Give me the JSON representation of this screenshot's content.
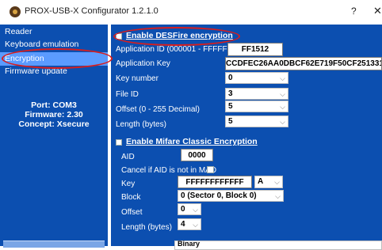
{
  "window": {
    "title": "PROX-USB-X Configurator 1.2.1.0",
    "help": "?",
    "close": "✕"
  },
  "sidebar": {
    "items": [
      {
        "label": "Reader"
      },
      {
        "label": "Keyboard emulation"
      },
      {
        "label": "Encryption",
        "selected": true
      },
      {
        "label": "Firmware update"
      }
    ],
    "port": "Port: COM3",
    "firmware": "Firmware: 2.30",
    "concept": "Concept: Xsecure"
  },
  "desfire": {
    "enable_label": "Enable DESFire encryption",
    "app_id_label": "Application ID (000001 - FFFFFF)",
    "app_id_value": "FF1512",
    "app_key_label": "Application Key",
    "app_key_value": "CCDFEC26AA0DBCF62E719F50CF251331",
    "key_number_label": "Key number",
    "key_number_value": "0",
    "file_id_label": "File ID",
    "file_id_value": "3",
    "offset_label": "Offset (0 - 255 Decimal)",
    "offset_value": "5",
    "length_label": "Length (bytes)",
    "length_value": "5"
  },
  "mifare": {
    "enable_label": "Enable Mifare Classic Encryption",
    "aid_label": "AID",
    "aid_value": "0000",
    "cancel_label": "Cancel if AID is not in MAD",
    "key_label": "Key",
    "key_value": "FFFFFFFFFFFF",
    "key_type_value": "A",
    "block_label": "Block",
    "block_value": "0 (Sector 0, Block 0)",
    "offset_label": "Offset",
    "offset_value": "0",
    "length_label": "Length (bytes)",
    "length_value": "4"
  },
  "bottom": {
    "value": "Binary"
  },
  "colors": {
    "background": "#0c4fb0",
    "selected": "#5b9bff",
    "annotation": "#d81e1e"
  },
  "icons": {
    "app": "prox-app-icon",
    "chevron": "chevron-down-icon"
  }
}
